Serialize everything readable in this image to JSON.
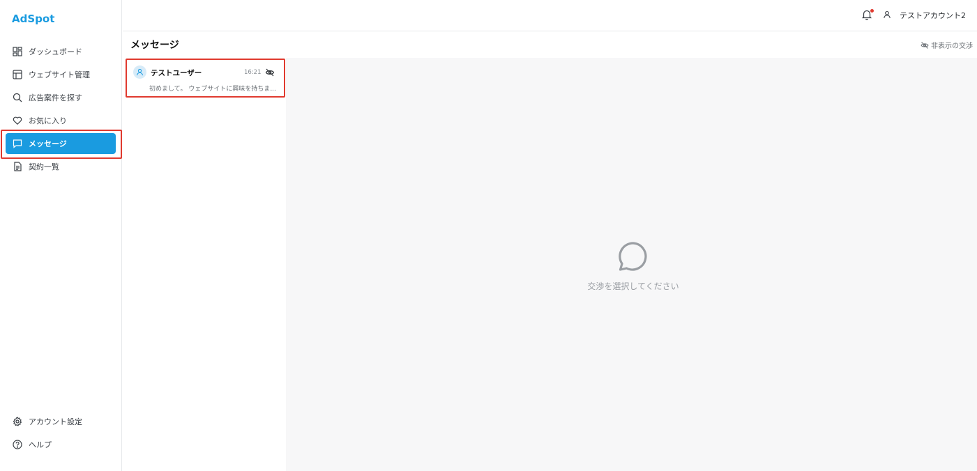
{
  "app": {
    "name": "AdSpot"
  },
  "sidebar": {
    "items": [
      {
        "label": "ダッシュボード",
        "icon": "dashboard-icon"
      },
      {
        "label": "ウェブサイト管理",
        "icon": "layout-icon"
      },
      {
        "label": "広告案件を探す",
        "icon": "search-icon"
      },
      {
        "label": "お気に入り",
        "icon": "heart-icon"
      },
      {
        "label": "メッセージ",
        "icon": "message-icon",
        "active": true
      },
      {
        "label": "契約一覧",
        "icon": "document-icon"
      }
    ],
    "bottom_items": [
      {
        "label": "アカウント設定",
        "icon": "gear-icon"
      },
      {
        "label": "ヘルプ",
        "icon": "help-icon"
      }
    ],
    "active_color": "#1a9be0"
  },
  "header": {
    "account_name": "テストアカウント2",
    "notification_badge": true
  },
  "page": {
    "title": "メッセージ",
    "hidden_toggle_label": "非表示の交渉"
  },
  "conversations": [
    {
      "name": "テストユーザー",
      "time": "16:21",
      "preview": "初めまして。 ウェブサイトに興味を持ちま..."
    }
  ],
  "empty_state": {
    "message": "交渉を選択してください",
    "icon": "chat-bubble-icon"
  },
  "colors": {
    "brand": "#1a9be0",
    "highlight": "#e03a2f",
    "detail_bg": "#f7f7f8"
  }
}
